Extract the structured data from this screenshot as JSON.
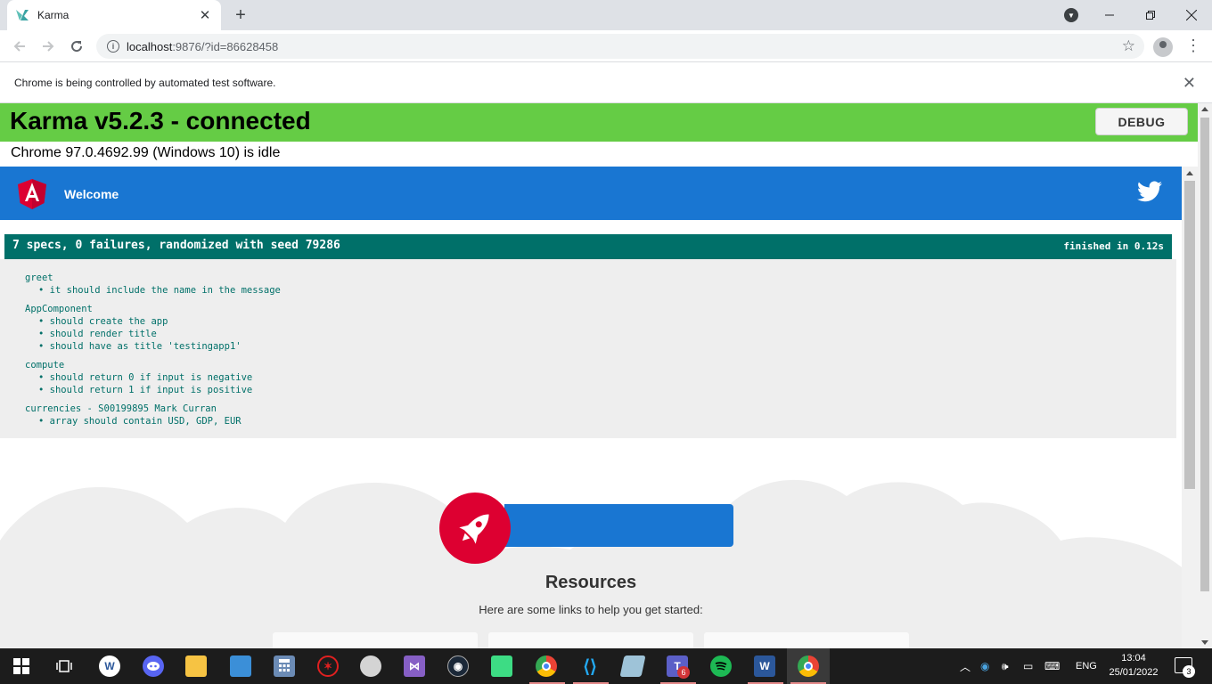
{
  "browser": {
    "tab_title": "Karma",
    "url_host": "localhost",
    "url_rest": ":9876/?id=86628458",
    "infobar_text": "Chrome is being controlled by automated test software."
  },
  "karma": {
    "title": "Karma v5.2.3 - connected",
    "debug_label": "DEBUG",
    "browser_status": "Chrome 97.0.4692.99 (Windows 10) is idle"
  },
  "app": {
    "toolbar_title": "Welcome",
    "resources_title": "Resources",
    "resources_subtitle": "Here are some links to help you get started:"
  },
  "jasmine": {
    "summary": "7 specs, 0 failures, randomized with seed 79286",
    "duration": "finished in 0.12s",
    "suites": [
      {
        "name": "greet",
        "specs": [
          "it should include the name in the message"
        ]
      },
      {
        "name": "AppComponent",
        "specs": [
          "should create the app",
          "should render title",
          "should have as title 'testingapp1'"
        ]
      },
      {
        "name": "compute",
        "specs": [
          "should return 0 if input is negative",
          "should return 1 if input is positive"
        ]
      },
      {
        "name": "currencies - S00199895 Mark Curran",
        "specs": [
          "array should contain USD, GDP, EUR"
        ]
      }
    ]
  },
  "taskbar": {
    "lang": "ENG",
    "time": "13:04",
    "date": "25/01/2022",
    "teams_badge": "6",
    "notification_count": "3",
    "icons": [
      "windows-start-icon",
      "task-view-icon",
      "word-doc-icon",
      "discord-icon",
      "file-explorer-icon",
      "control-panel-icon",
      "calculator-icon",
      "game-icon",
      "paint-icon",
      "visual-studio-icon",
      "steam-icon",
      "android-studio-icon",
      "chrome-icon",
      "vscode-icon",
      "notepad-icon",
      "teams-icon",
      "spotify-icon",
      "word-icon",
      "chrome-active-icon"
    ]
  },
  "colors": {
    "karma_green": "#65cc45",
    "angular_blue": "#1976d2",
    "jasmine_teal": "#007069",
    "angular_red": "#dd0031"
  }
}
